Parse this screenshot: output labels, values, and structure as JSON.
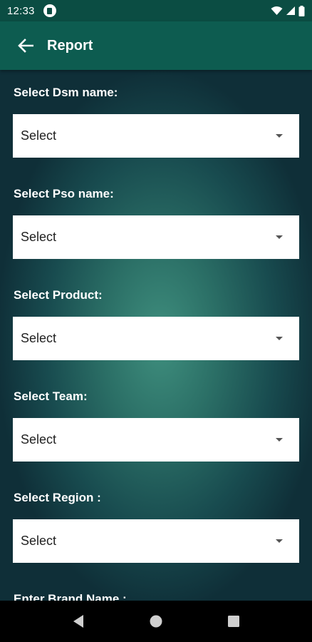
{
  "status_bar": {
    "time": "12:33",
    "icons": [
      "app-notification-icon",
      "wifi-icon",
      "signal-icon",
      "battery-icon"
    ]
  },
  "app_bar": {
    "title": "Report",
    "back_icon": "arrow-left-icon"
  },
  "form": {
    "fields": [
      {
        "label": "Select Dsm name:",
        "value": "Select"
      },
      {
        "label": "Select Pso name:",
        "value": "Select"
      },
      {
        "label": "Select Product:",
        "value": "Select"
      },
      {
        "label": "Select Team:",
        "value": "Select"
      },
      {
        "label": "Select Region :",
        "value": "Select"
      }
    ],
    "brand_label": "Enter Brand Name :"
  },
  "nav_bar": {
    "buttons": [
      "back-triangle-icon",
      "home-circle-icon",
      "recents-square-icon"
    ]
  },
  "colors": {
    "status_bar": "#0b4d43",
    "app_bar": "#0d5c50",
    "background_center": "#3f8f7e",
    "background_edge": "#0f2f38",
    "nav_bar": "#000000"
  }
}
